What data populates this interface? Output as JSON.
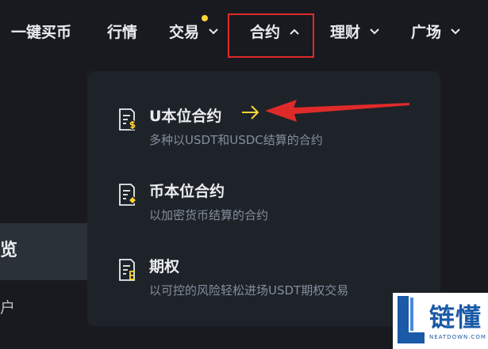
{
  "nav": {
    "items": [
      {
        "label": "一键买币"
      },
      {
        "label": "行情"
      },
      {
        "label": "交易"
      },
      {
        "label": "合约"
      },
      {
        "label": "理财"
      },
      {
        "label": "广场"
      }
    ]
  },
  "sidebar": {
    "active_label": "览",
    "sub_label": "户"
  },
  "dropdown": {
    "items": [
      {
        "title": "U本位合约",
        "desc": "多种以USDT和USDC结算的合约",
        "icon": "usd-contract-icon"
      },
      {
        "title": "币本位合约",
        "desc": "以加密货币结算的合约",
        "icon": "coin-contract-icon"
      },
      {
        "title": "期权",
        "desc": "以可控的风险轻松进场USDT期权交易",
        "icon": "options-icon"
      }
    ]
  },
  "watermark": {
    "text": "链懂",
    "sub": "NEATDOWN.COM"
  },
  "colors": {
    "background": "#181a20",
    "panel": "#1e2329",
    "accent": "#fcd535",
    "highlight": "#e02a2a"
  }
}
